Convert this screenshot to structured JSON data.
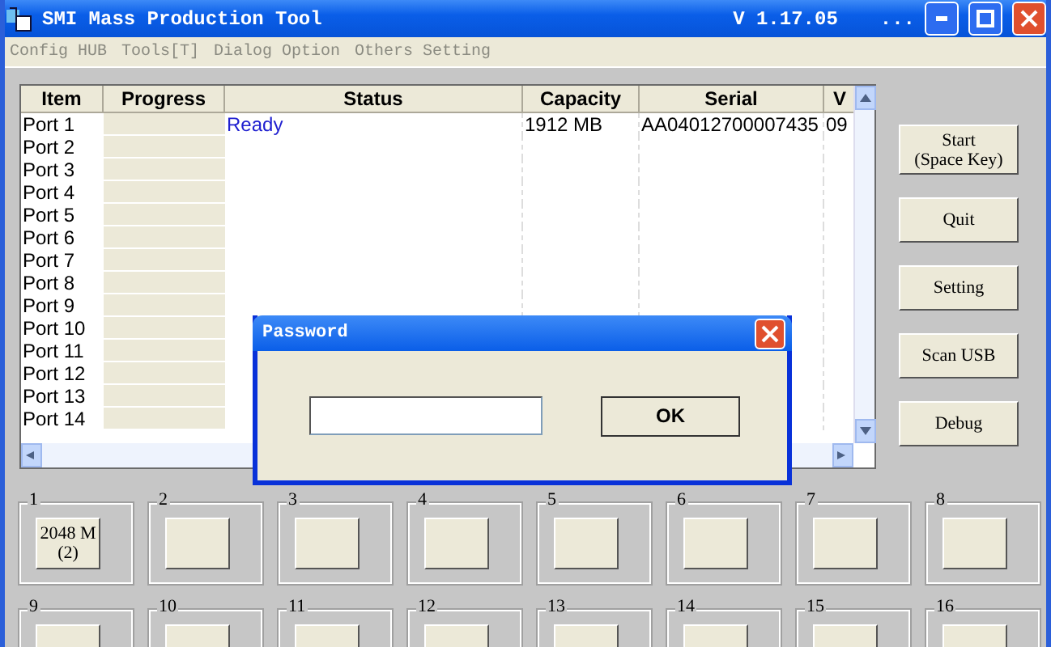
{
  "window": {
    "title": "SMI Mass Production Tool",
    "version": "V 1.17.05",
    "extra": "..."
  },
  "menu": [
    "Config HUB",
    "Tools[T]",
    "Dialog Option",
    "Others Setting"
  ],
  "table": {
    "columns": [
      "Item",
      "Progress",
      "Status",
      "Capacity",
      "Serial",
      "V"
    ],
    "rows": [
      {
        "item": "Port 1",
        "level": 0,
        "status": "Ready",
        "capacity": "1912 MB",
        "serial": "AA04012700007435",
        "column_6": "09"
      },
      {
        "item": "Port 2",
        "level": 0
      },
      {
        "item": "Port 3",
        "level": 0
      },
      {
        "item": "Port 4",
        "level": 0
      },
      {
        "item": "Port 5",
        "level": 0
      },
      {
        "item": "Port 6",
        "level": 0
      },
      {
        "item": "Port 7",
        "level": 0
      },
      {
        "item": "Port 8",
        "level": 0
      },
      {
        "item": "Port 9",
        "level": 0
      },
      {
        "item": "Port 10",
        "level": 0
      },
      {
        "item": "Port 11",
        "level": 0
      },
      {
        "item": "Port 12",
        "level": 0
      },
      {
        "item": "Port 13",
        "level": 0
      },
      {
        "item": "Port 14",
        "level": 0
      }
    ]
  },
  "buttons": [
    {
      "lines": [
        "Start",
        "(Space Key)"
      ]
    },
    {
      "lines": [
        "Quit"
      ]
    },
    {
      "lines": [
        "Setting"
      ]
    },
    {
      "lines": [
        "Scan USB"
      ]
    },
    {
      "lines": [
        "Debug"
      ]
    }
  ],
  "ports": [
    {
      "label": "1",
      "lines": [
        "2048 M",
        "(2)"
      ]
    },
    {
      "label": "2"
    },
    {
      "label": "3"
    },
    {
      "label": "4"
    },
    {
      "label": "5"
    },
    {
      "label": "6"
    },
    {
      "label": "7"
    },
    {
      "label": "8"
    },
    {
      "label": "9"
    },
    {
      "label": "10"
    },
    {
      "label": "11"
    },
    {
      "label": "12"
    },
    {
      "label": "13"
    },
    {
      "label": "14"
    },
    {
      "label": "15"
    },
    {
      "label": "16"
    }
  ],
  "dialog": {
    "title": "Password",
    "ok": "OK"
  }
}
